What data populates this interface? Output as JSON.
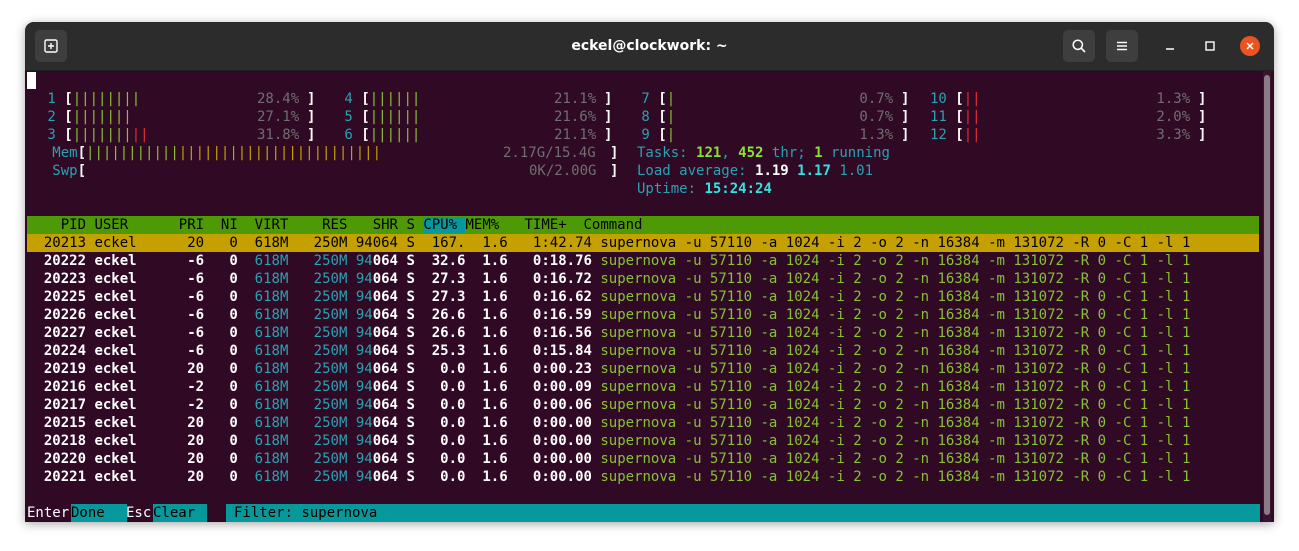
{
  "window": {
    "title": "eckel@clockwork: ~"
  },
  "colors": {
    "terminal_bg": "#300a24",
    "header_bg": "#4e9a06",
    "selected_row_bg": "#c4a000",
    "filter_bar_bg": "#06989a",
    "close_button": "#e95420"
  },
  "icons": [
    "new-tab-icon",
    "search-icon",
    "hamburger-menu-icon",
    "minimize-icon",
    "maximize-icon",
    "close-icon"
  ],
  "meters": {
    "cpus": [
      {
        "num": "1",
        "bars": "||||||||",
        "pct": "28.4%"
      },
      {
        "num": "2",
        "bars": "|||||||",
        "pct": "27.1%"
      },
      {
        "num": "3",
        "bars": "|||||||",
        "bars_red": "||",
        "pct": "31.8%"
      },
      {
        "num": "4",
        "bars": "||||||",
        "pct": "21.1%"
      },
      {
        "num": "5",
        "bars": "||||||",
        "pct": "21.6%"
      },
      {
        "num": "6",
        "bars": "||||||",
        "pct": "21.1%"
      },
      {
        "num": "7",
        "bars": "|",
        "pct": "0.7%"
      },
      {
        "num": "8",
        "bars": "|",
        "pct": "0.7%"
      },
      {
        "num": "9",
        "bars": "|",
        "pct": "1.3%"
      },
      {
        "num": "10",
        "bars_red": "||",
        "pct": "1.3%"
      },
      {
        "num": "11",
        "bars_red": "||",
        "pct": "2.0%"
      },
      {
        "num": "12",
        "bars_red": "||",
        "pct": "3.3%"
      }
    ],
    "mem": {
      "label": "Mem",
      "bars_green": "|||||||||||",
      "bars_orange": "||||||||||||||||||||||||",
      "value": "2.17G/15.4G"
    },
    "swp": {
      "label": "Swp",
      "value": "0K/2.00G"
    },
    "tasks": {
      "label": "Tasks:",
      "count": "121",
      "threads": "452",
      "thr_label": "thr;",
      "running": "1",
      "running_label": "running"
    },
    "load": {
      "label": "Load average:",
      "l1": "1.19",
      "l5": "1.17",
      "l15": "1.01"
    },
    "uptime": {
      "label": "Uptime:",
      "value": "15:24:24"
    }
  },
  "table": {
    "headers": [
      "PID",
      "USER",
      "PRI",
      "NI",
      "VIRT",
      "RES",
      "SHR",
      "S",
      "CPU%",
      "MEM%",
      "TIME+",
      "Command"
    ],
    "command": "supernova -u 57110 -a 1024 -i 2 -o 2 -n 16384 -m 131072 -R 0 -C 1 -l 1",
    "rows": [
      {
        "pid": "20213",
        "user": "eckel",
        "pri": "20",
        "ni": "0",
        "virt": "618M",
        "res": "250M",
        "shr_a": "94",
        "shr_b": "064",
        "s": "S",
        "cpu": "167.",
        "mem": "1.6",
        "time": "1:42.74"
      },
      {
        "pid": "20222",
        "user": "eckel",
        "pri": "-6",
        "ni": "0",
        "virt": "618M",
        "res": "250M",
        "shr_a": "94",
        "shr_b": "064",
        "s": "S",
        "cpu": "32.6",
        "mem": "1.6",
        "time": "0:18.76"
      },
      {
        "pid": "20223",
        "user": "eckel",
        "pri": "-6",
        "ni": "0",
        "virt": "618M",
        "res": "250M",
        "shr_a": "94",
        "shr_b": "064",
        "s": "S",
        "cpu": "27.3",
        "mem": "1.6",
        "time": "0:16.72"
      },
      {
        "pid": "20225",
        "user": "eckel",
        "pri": "-6",
        "ni": "0",
        "virt": "618M",
        "res": "250M",
        "shr_a": "94",
        "shr_b": "064",
        "s": "S",
        "cpu": "27.3",
        "mem": "1.6",
        "time": "0:16.62"
      },
      {
        "pid": "20226",
        "user": "eckel",
        "pri": "-6",
        "ni": "0",
        "virt": "618M",
        "res": "250M",
        "shr_a": "94",
        "shr_b": "064",
        "s": "S",
        "cpu": "26.6",
        "mem": "1.6",
        "time": "0:16.59"
      },
      {
        "pid": "20227",
        "user": "eckel",
        "pri": "-6",
        "ni": "0",
        "virt": "618M",
        "res": "250M",
        "shr_a": "94",
        "shr_b": "064",
        "s": "S",
        "cpu": "26.6",
        "mem": "1.6",
        "time": "0:16.56"
      },
      {
        "pid": "20224",
        "user": "eckel",
        "pri": "-6",
        "ni": "0",
        "virt": "618M",
        "res": "250M",
        "shr_a": "94",
        "shr_b": "064",
        "s": "S",
        "cpu": "25.3",
        "mem": "1.6",
        "time": "0:15.84"
      },
      {
        "pid": "20219",
        "user": "eckel",
        "pri": "20",
        "ni": "0",
        "virt": "618M",
        "res": "250M",
        "shr_a": "94",
        "shr_b": "064",
        "s": "S",
        "cpu": "0.0",
        "mem": "1.6",
        "time": "0:00.23"
      },
      {
        "pid": "20216",
        "user": "eckel",
        "pri": "-2",
        "ni": "0",
        "virt": "618M",
        "res": "250M",
        "shr_a": "94",
        "shr_b": "064",
        "s": "S",
        "cpu": "0.0",
        "mem": "1.6",
        "time": "0:00.09"
      },
      {
        "pid": "20217",
        "user": "eckel",
        "pri": "-2",
        "ni": "0",
        "virt": "618M",
        "res": "250M",
        "shr_a": "94",
        "shr_b": "064",
        "s": "S",
        "cpu": "0.0",
        "mem": "1.6",
        "time": "0:00.06"
      },
      {
        "pid": "20215",
        "user": "eckel",
        "pri": "20",
        "ni": "0",
        "virt": "618M",
        "res": "250M",
        "shr_a": "94",
        "shr_b": "064",
        "s": "S",
        "cpu": "0.0",
        "mem": "1.6",
        "time": "0:00.00"
      },
      {
        "pid": "20218",
        "user": "eckel",
        "pri": "20",
        "ni": "0",
        "virt": "618M",
        "res": "250M",
        "shr_a": "94",
        "shr_b": "064",
        "s": "S",
        "cpu": "0.0",
        "mem": "1.6",
        "time": "0:00.00"
      },
      {
        "pid": "20220",
        "user": "eckel",
        "pri": "20",
        "ni": "0",
        "virt": "618M",
        "res": "250M",
        "shr_a": "94",
        "shr_b": "064",
        "s": "S",
        "cpu": "0.0",
        "mem": "1.6",
        "time": "0:00.00"
      },
      {
        "pid": "20221",
        "user": "eckel",
        "pri": "20",
        "ni": "0",
        "virt": "618M",
        "res": "250M",
        "shr_a": "94",
        "shr_b": "064",
        "s": "S",
        "cpu": "0.0",
        "mem": "1.6",
        "time": "0:00.00"
      }
    ]
  },
  "footer": {
    "enter_key": "Enter",
    "enter_label": "Done",
    "esc_key": "Esc",
    "esc_label": "Clear",
    "filter_label": "Filter:",
    "filter_value": "supernova"
  }
}
